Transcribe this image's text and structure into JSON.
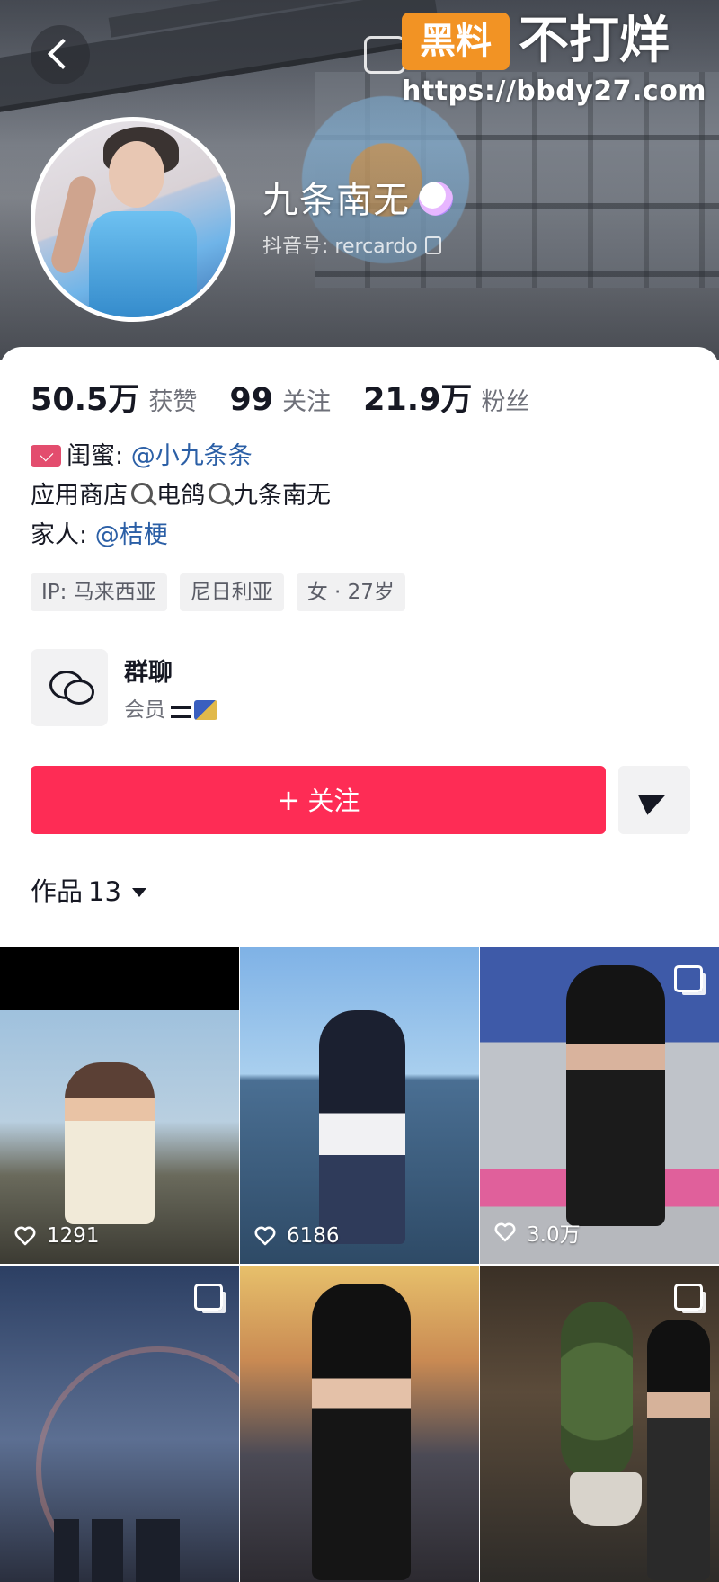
{
  "watermark": {
    "badge": "黑料",
    "title": "不打烊",
    "url": "https://bbdy27.com"
  },
  "profile": {
    "name": "九条南无",
    "handle_label": "抖音号:",
    "handle": "rercardo"
  },
  "stats": [
    {
      "value": "50.5万",
      "label": "获赞"
    },
    {
      "value": "99",
      "label": "关注"
    },
    {
      "value": "21.9万",
      "label": "粉丝"
    }
  ],
  "bio": {
    "line1_prefix": "闺蜜:",
    "line1_link": "@小九条条",
    "line2_a": "应用商店",
    "line2_b": "电鸽",
    "line2_c": "九条南无",
    "line3_prefix": "家人:",
    "line3_link": "@桔梗"
  },
  "tags": [
    "IP: 马来西亚",
    "尼日利亚",
    "女 · 27岁"
  ],
  "group_chat": {
    "title": "群聊",
    "subtitle": "会员"
  },
  "follow_button": {
    "plus": "+",
    "label": "关注"
  },
  "works_tab": {
    "label": "作品",
    "count": "13"
  },
  "works": [
    {
      "likes": "1291",
      "multi": false
    },
    {
      "likes": "6186",
      "multi": false
    },
    {
      "likes": "3.0万",
      "multi": true
    },
    {
      "likes": "",
      "multi": true
    },
    {
      "likes": "",
      "multi": false
    },
    {
      "likes": "",
      "multi": true
    }
  ],
  "colors": {
    "accent": "#fe2c55",
    "link": "#2b5fa6",
    "watermark_badge": "#f29324"
  }
}
